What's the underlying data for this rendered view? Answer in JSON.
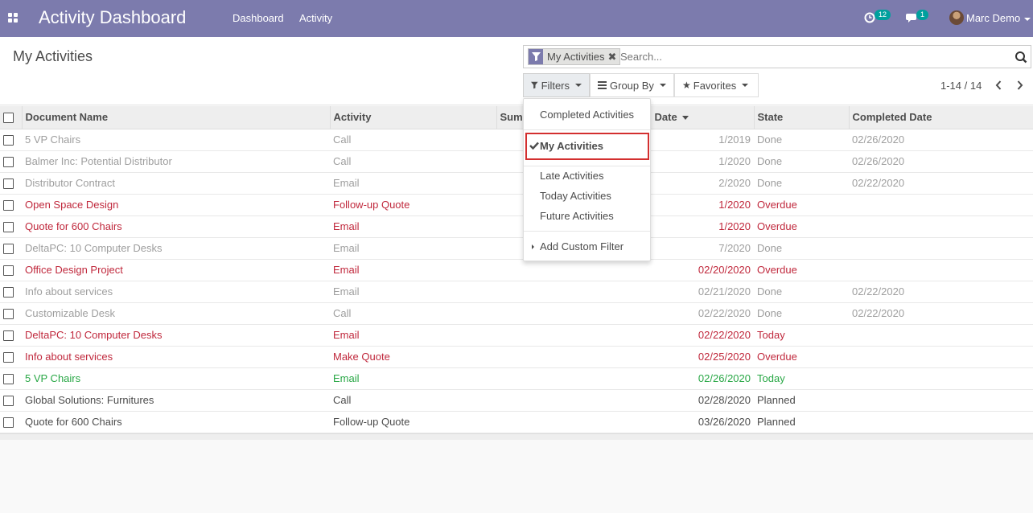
{
  "navbar": {
    "brand": "Activity Dashboard",
    "menu": [
      "Dashboard",
      "Activity"
    ],
    "activity_count": "12",
    "message_count": "1",
    "user_name": "Marc Demo",
    "bg_color": "#7c7bad"
  },
  "control_panel": {
    "title": "My Activities",
    "search": {
      "facet_label": "My Activities",
      "placeholder": "Search..."
    },
    "buttons": {
      "filters": "Filters",
      "group_by": "Group By",
      "favorites": "Favorites"
    },
    "pager": "1-14 / 14"
  },
  "table": {
    "columns": [
      "Document Name",
      "Activity",
      "Sum",
      "Date",
      "State",
      "Completed Date"
    ],
    "rows": [
      {
        "name": "5 VP Chairs",
        "activity": "Call",
        "date": "1/2019",
        "state": "Done",
        "completed": "02/26/2020",
        "status": "done"
      },
      {
        "name": "Balmer Inc: Potential Distributor",
        "activity": "Call",
        "date": "1/2020",
        "state": "Done",
        "completed": "02/26/2020",
        "status": "done"
      },
      {
        "name": "Distributor Contract",
        "activity": "Email",
        "date": "2/2020",
        "state": "Done",
        "completed": "02/22/2020",
        "status": "done"
      },
      {
        "name": "Open Space Design",
        "activity": "Follow-up Quote",
        "date": "1/2020",
        "state": "Overdue",
        "completed": "",
        "status": "overdue"
      },
      {
        "name": "Quote for 600 Chairs",
        "activity": "Email",
        "date": "1/2020",
        "state": "Overdue",
        "completed": "",
        "status": "overdue"
      },
      {
        "name": "DeltaPC: 10 Computer Desks",
        "activity": "Email",
        "date": "7/2020",
        "state": "Done",
        "completed": "",
        "status": "done"
      },
      {
        "name": "Office Design Project",
        "activity": "Email",
        "date": "02/20/2020",
        "state": "Overdue",
        "completed": "",
        "status": "overdue"
      },
      {
        "name": "Info about services",
        "activity": "Email",
        "date": "02/21/2020",
        "state": "Done",
        "completed": "02/22/2020",
        "status": "done"
      },
      {
        "name": "Customizable Desk",
        "activity": "Call",
        "date": "02/22/2020",
        "state": "Done",
        "completed": "02/22/2020",
        "status": "done"
      },
      {
        "name": "DeltaPC: 10 Computer Desks",
        "activity": "Email",
        "date": "02/22/2020",
        "state": "Today",
        "completed": "",
        "status": "overdue"
      },
      {
        "name": "Info about services",
        "activity": "Make Quote",
        "date": "02/25/2020",
        "state": "Overdue",
        "completed": "",
        "status": "overdue"
      },
      {
        "name": "5 VP Chairs",
        "activity": "Email",
        "date": "02/26/2020",
        "state": "Today",
        "completed": "",
        "status": "today"
      },
      {
        "name": "Global Solutions: Furnitures",
        "activity": "Call",
        "date": "02/28/2020",
        "state": "Planned",
        "completed": "",
        "status": "planned"
      },
      {
        "name": "Quote for 600 Chairs",
        "activity": "Follow-up Quote",
        "date": "03/26/2020",
        "state": "Planned",
        "completed": "",
        "status": "planned"
      }
    ]
  },
  "filter_dropdown": {
    "completed": "Completed Activities",
    "my_activities": "My Activities",
    "late": "Late Activities",
    "today": "Today Activities",
    "future": "Future Activities",
    "add_custom": "Add Custom Filter"
  }
}
